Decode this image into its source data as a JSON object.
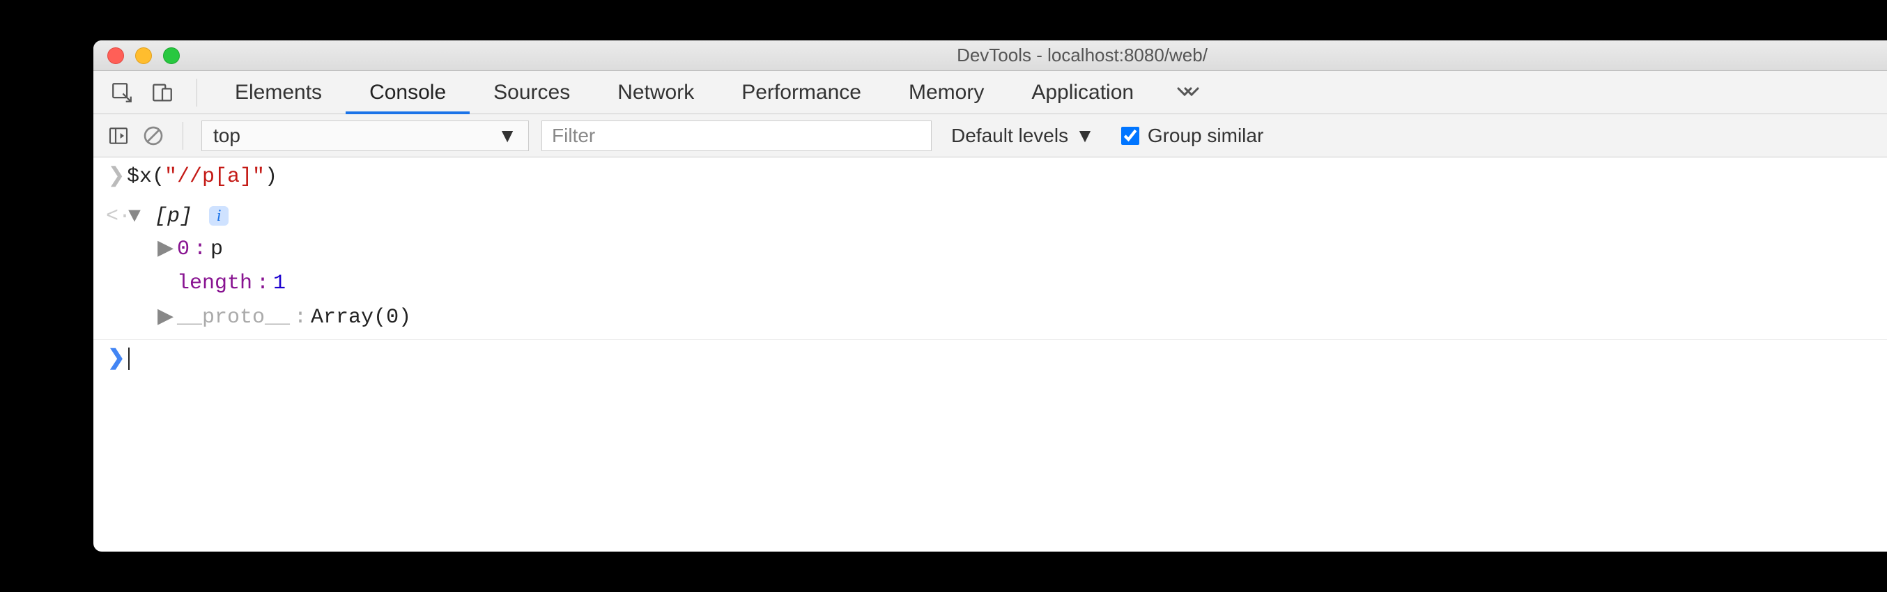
{
  "window": {
    "title": "DevTools - localhost:8080/web/"
  },
  "tabs": {
    "items": [
      "Elements",
      "Console",
      "Sources",
      "Network",
      "Performance",
      "Memory",
      "Application"
    ],
    "active_index": 1
  },
  "console_toolbar": {
    "context": "top",
    "filter_placeholder": "Filter",
    "levels_label": "Default levels",
    "group_similar_label": "Group similar",
    "group_similar_checked": true
  },
  "console": {
    "input_expr": {
      "fn": "$x",
      "arg_string": "\"//p[a]\""
    },
    "result": {
      "summary_open": "[",
      "summary_item": "p",
      "summary_close": "]",
      "entries": [
        {
          "key": "0",
          "val": "p",
          "expandable": true
        },
        {
          "key": "length",
          "val": "1",
          "numeric": true
        },
        {
          "key": "__proto__",
          "val": "Array(0)",
          "expandable": true,
          "dim": true
        }
      ]
    }
  }
}
